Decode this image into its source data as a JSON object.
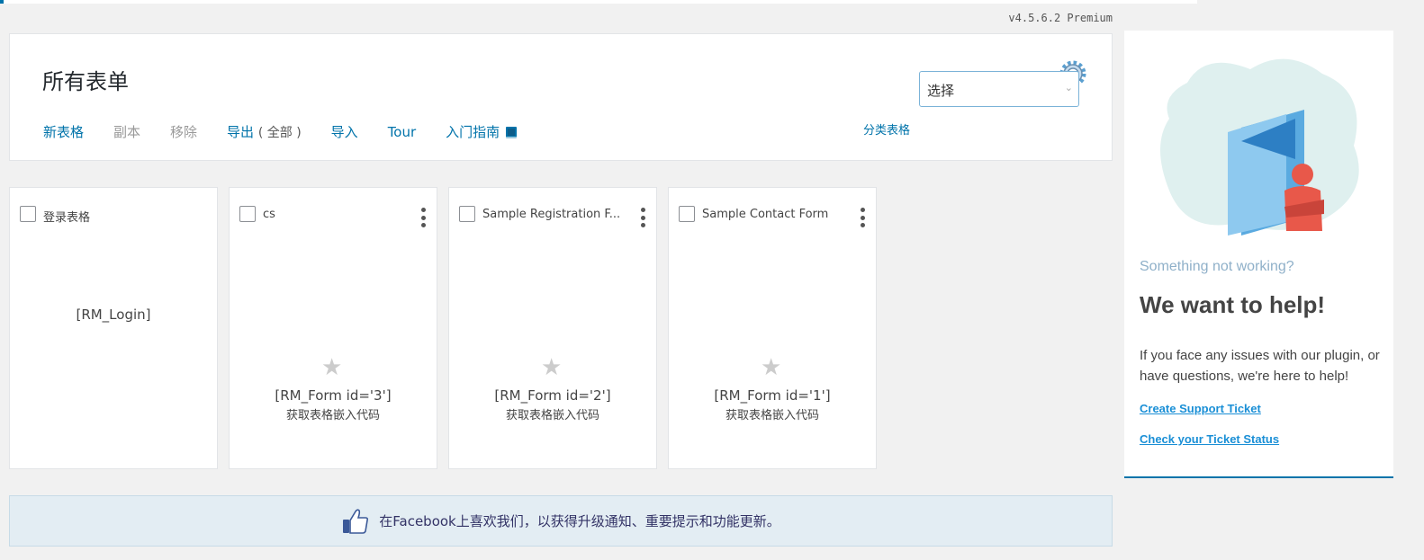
{
  "version": "v4.5.6.2 Premium",
  "header": {
    "title": "所有表单",
    "toolbar": {
      "new_form": "新表格",
      "duplicate": "副本",
      "remove": "移除",
      "export": "导出",
      "export_all": "( 全部 )",
      "import": "导入",
      "tour": "Tour",
      "guide": "入门指南"
    },
    "category_label": "分类表格",
    "category_select": "选择"
  },
  "cards": [
    {
      "name": "登录表格",
      "code": "[RM_Login]",
      "embed": ""
    },
    {
      "name": "cs",
      "code": "[RM_Form id='3']",
      "embed": "获取表格嵌入代码"
    },
    {
      "name": "Sample Registration F...",
      "code": "[RM_Form id='2']",
      "embed": "获取表格嵌入代码"
    },
    {
      "name": "Sample Contact Form",
      "code": "[RM_Form id='1']",
      "embed": "获取表格嵌入代码"
    }
  ],
  "facebook_bar": "在Facebook上喜欢我们，以获得升级通知、重要提示和功能更新。",
  "help": {
    "subtitle": "Something not working?",
    "title": "We want to help!",
    "text": "If you face any issues with our plugin, or have questions, we're here to help!",
    "create_ticket": "Create Support Ticket",
    "check_ticket": "Check your Ticket Status"
  },
  "colors": {
    "accent": "#0073aa",
    "link": "#1a8fd6"
  }
}
